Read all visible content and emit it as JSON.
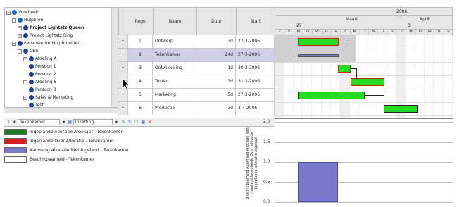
{
  "tree": {
    "items": [
      {
        "label": "Voorbeeld",
        "level": 0
      },
      {
        "label": "Hulpbron",
        "level": 1
      },
      {
        "label": "Project Lightstz Queen",
        "level": 2,
        "bold": true
      },
      {
        "label": "Project Lightstz Ring",
        "level": 2
      },
      {
        "label": "Personen for Hulpbroniden",
        "level": 1
      },
      {
        "label": "OBS",
        "level": 2
      },
      {
        "label": "Afdeling A",
        "level": 3
      },
      {
        "label": "Persoon 1",
        "level": 4
      },
      {
        "label": "Persoon 2",
        "level": 4
      },
      {
        "label": "Afdeling B",
        "level": 3
      },
      {
        "label": "Persoon 3",
        "level": 4
      },
      {
        "label": "Sales & Marketing",
        "level": 3
      },
      {
        "label": "Test",
        "level": 4
      }
    ]
  },
  "table": {
    "headers": {
      "regel": "Regel",
      "naam": "Naam",
      "duur": "Duur",
      "start": "Start"
    },
    "rows": [
      {
        "regel": "1",
        "naam": "Ontwerp",
        "duur": "3d",
        "start": "27-3-2006"
      },
      {
        "regel": "2",
        "naam": "Tekenkamer",
        "duur": "24d",
        "start": "27-3-2006"
      },
      {
        "regel": "3",
        "naam": "Ontwikkeling",
        "duur": "1d",
        "start": "30-3-2006"
      },
      {
        "regel": "4",
        "naam": "Testen",
        "duur": "3d",
        "start": "31-3-2006"
      },
      {
        "regel": "5",
        "naam": "Marketing",
        "duur": "5d",
        "start": "27-3-2006"
      },
      {
        "regel": "6",
        "naam": "Productie",
        "duur": "3d",
        "start": "3-4-2006"
      }
    ]
  },
  "gantt": {
    "year": "2006",
    "months": [
      "Maart",
      "April"
    ],
    "week_labels": [
      "27",
      "3"
    ],
    "day_letters": [
      "Z",
      "V",
      "M",
      "D",
      "W",
      "D",
      "V",
      "Z",
      "M",
      "D",
      "W",
      "D",
      "V",
      "Z",
      "M",
      "D",
      "W",
      "D",
      "V"
    ]
  },
  "toolbar": {
    "resource": "Tekenkamer",
    "view": "Inzetting"
  },
  "legend": [
    {
      "label": "Ingeplande Allocatie Afgekapt - Tekenkamer",
      "color": "#1e7a1e"
    },
    {
      "label": "Ingeplande Over Allocatie - Tekenkamer",
      "color": "#d62020"
    },
    {
      "label": "Aanvraag Allocatie Niet-ingeland - Tekenkamer",
      "color": "#7a7acc"
    },
    {
      "label": "Beschikbaarheid - Tekenkamer",
      "color": "#ffffff"
    }
  ],
  "histogram": {
    "axis_title": "Beschikbaarheid Aanvraag Allocatie Niet-ingeland Ingeplande Over allocatie Ingeplande allocatie Afgekapt",
    "ticks": [
      "2.0",
      "1.5",
      "1.0",
      "0.5",
      "0.0"
    ]
  },
  "colors": {
    "task_green": "#22dd22",
    "task_border": "#cc2200",
    "selected_row": "#cfcfe8",
    "summary": "#7a7acc"
  }
}
